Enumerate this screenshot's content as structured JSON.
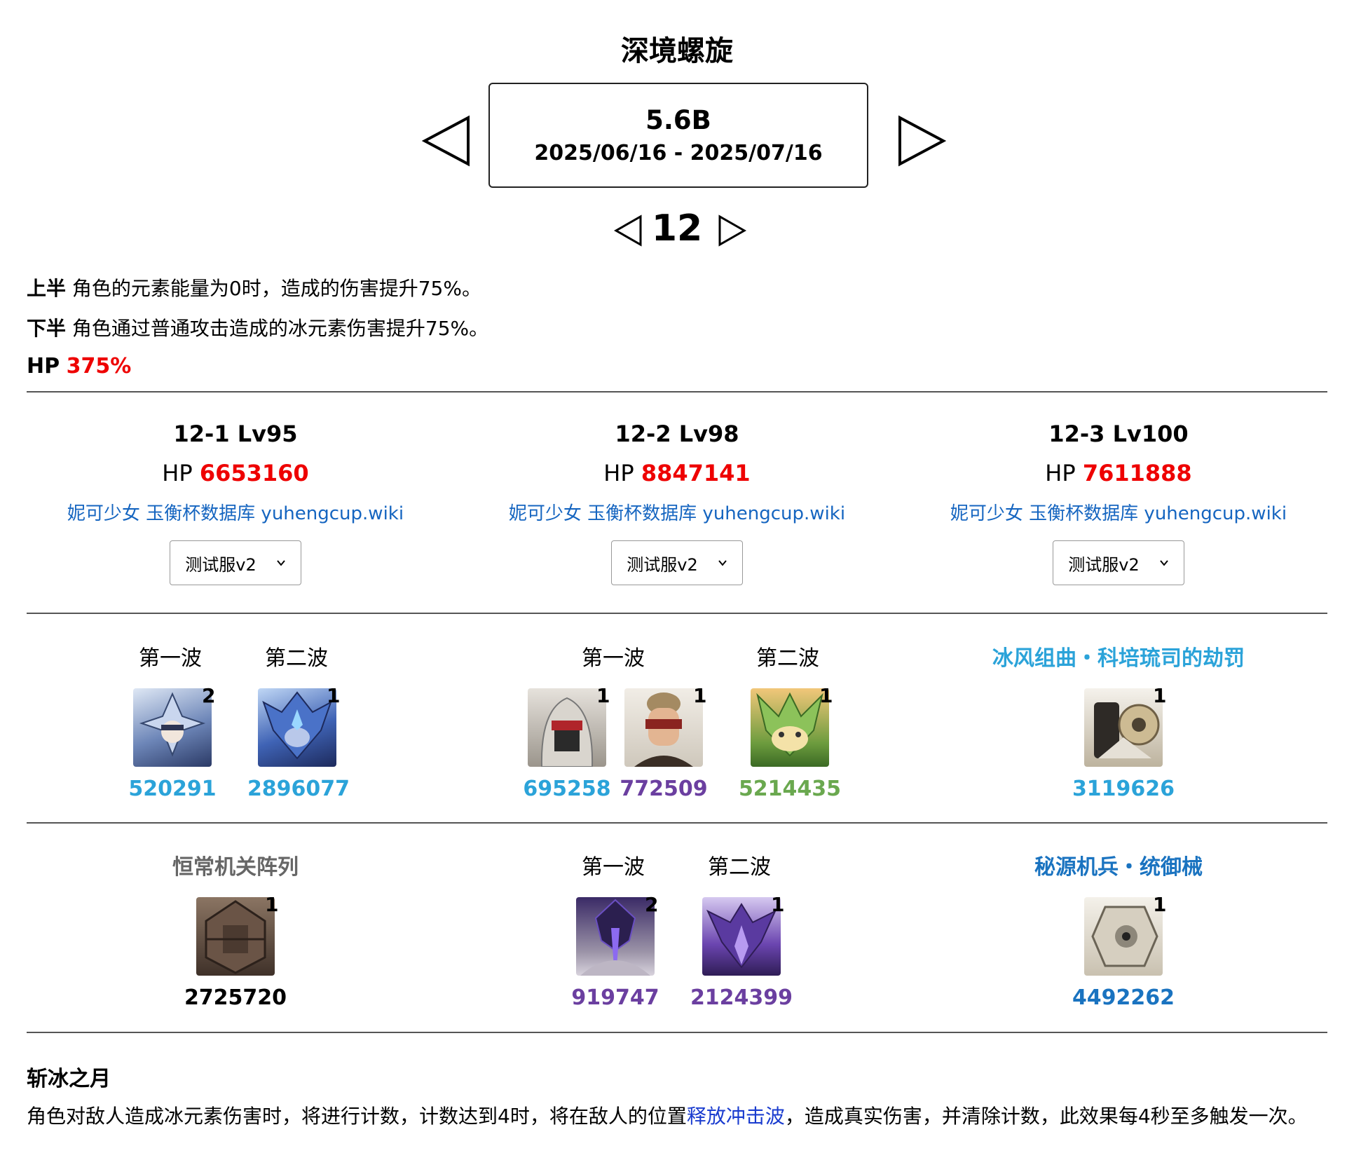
{
  "header": {
    "title": "深境螺旋",
    "version": "5.6B",
    "date_range": "2025/06/16 - 2025/07/16",
    "floor": "12"
  },
  "blessings": {
    "first_half_label": "上半",
    "first_half_text": "角色的元素能量为0时，造成的伤害提升75%。",
    "second_half_label": "下半",
    "second_half_text": "角色通过普通攻击造成的冰元素伤害提升75%。",
    "hp_label": "HP",
    "hp_value": "375%"
  },
  "chambers": [
    {
      "title": "12-1 Lv95",
      "hp_label": "HP",
      "hp": "6653160",
      "link": "妮可少女 玉衡杯数据库 yuhengcup.wiki",
      "select": "测试服v2"
    },
    {
      "title": "12-2 Lv98",
      "hp_label": "HP",
      "hp": "8847141",
      "link": "妮可少女 玉衡杯数据库 yuhengcup.wiki",
      "select": "测试服v2"
    },
    {
      "title": "12-3 Lv100",
      "hp_label": "HP",
      "hp": "7611888",
      "link": "妮可少女 玉衡杯数据库 yuhengcup.wiki",
      "select": "测试服v2"
    }
  ],
  "upper": {
    "c1": {
      "wave1_label": "第一波",
      "wave2_label": "第二波",
      "enemies": [
        {
          "icon": "ice-mage-enemy-icon",
          "count": "2",
          "hp": "520291",
          "color": "#2ba3d9"
        },
        {
          "icon": "ice-lector-enemy-icon",
          "count": "1",
          "hp": "2896077",
          "color": "#2ba3d9"
        }
      ]
    },
    "c2": {
      "wave1_label": "第一波",
      "wave2_label": "第二波",
      "enemies": [
        {
          "icon": "eremite-veiled-enemy-icon",
          "count": "1",
          "hp": "695258",
          "color": "#2ba3d9"
        },
        {
          "icon": "eremite-masked-enemy-icon",
          "count": "1",
          "hp": "772509",
          "color": "#6b3fa0"
        },
        {
          "icon": "dendro-beast-enemy-icon",
          "count": "1",
          "hp": "5214435",
          "color": "#6aa84f"
        }
      ]
    },
    "c3": {
      "group_label": "冰风组曲・科培琉司的劫罚",
      "enemies": [
        {
          "icon": "icewind-suite-enemy-icon",
          "count": "1",
          "hp": "3119626",
          "color": "#2ba3d9"
        }
      ]
    }
  },
  "lower": {
    "c1": {
      "group_label": "恒常机关阵列",
      "enemies": [
        {
          "icon": "perpetual-mechanical-array-icon",
          "count": "1",
          "hp": "2725720",
          "color": "#000000"
        }
      ]
    },
    "c2": {
      "wave1_label": "第一波",
      "wave2_label": "第二波",
      "enemies": [
        {
          "icon": "electro-knight-enemy-icon",
          "count": "2",
          "hp": "919747",
          "color": "#6b3fa0"
        },
        {
          "icon": "electro-dragon-enemy-icon",
          "count": "1",
          "hp": "2124399",
          "color": "#6b3fa0"
        }
      ]
    },
    "c3": {
      "group_label": "秘源机兵・统御械",
      "enemies": [
        {
          "icon": "secret-source-automaton-icon",
          "count": "1",
          "hp": "4492262",
          "color": "#1a73c0"
        }
      ]
    }
  },
  "moon": {
    "title": "斩冰之月",
    "desc_before": "角色对敌人造成冰元素伤害时，将进行计数，计数达到4时，将在敌人的位置",
    "desc_link": "释放冲击波",
    "desc_after": "，造成真实伤害，并清除计数，此效果每4秒至多触发一次。"
  }
}
